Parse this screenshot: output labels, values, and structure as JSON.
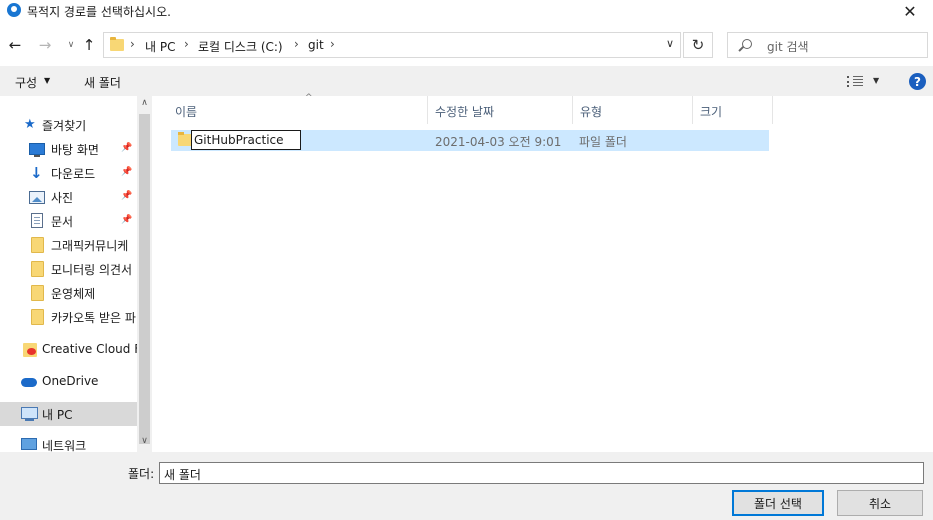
{
  "window": {
    "title": "목적지 경로를 선택하십시오.",
    "close": "✕"
  },
  "nav": {
    "back": "←",
    "forward": "→",
    "recent": "∨",
    "up": "↑",
    "refresh": "↻"
  },
  "address": {
    "crumbs": [
      "내 PC",
      "로컬 디스크 (C:)",
      "git"
    ],
    "separator": "›",
    "dropdown": "∨"
  },
  "search": {
    "placeholder": "git 검색"
  },
  "toolbar": {
    "organize": "구성",
    "organize_caret": "▼",
    "new_folder": "새 폴더",
    "view_caret": "▼",
    "help": "?"
  },
  "sidebar": {
    "items": [
      {
        "label": "즐겨찾기",
        "icon": "star-icon"
      },
      {
        "label": "바탕 화면",
        "icon": "desktop-icon",
        "pinned": true
      },
      {
        "label": "다운로드",
        "icon": "download-icon",
        "pinned": true
      },
      {
        "label": "사진",
        "icon": "pictures-icon",
        "pinned": true
      },
      {
        "label": "문서",
        "icon": "documents-icon",
        "pinned": true
      },
      {
        "label": "그래픽커뮤니케",
        "icon": "folder-icon"
      },
      {
        "label": "모니터링 의견서",
        "icon": "folder-icon"
      },
      {
        "label": "운영체제",
        "icon": "folder-icon"
      },
      {
        "label": "카카오톡 받은 파",
        "icon": "folder-icon"
      },
      {
        "label": "Creative Cloud Fil",
        "icon": "creative-cloud-icon"
      },
      {
        "label": "OneDrive",
        "icon": "onedrive-icon"
      },
      {
        "label": "내 PC",
        "icon": "pc-icon",
        "selected": true
      },
      {
        "label": "네트워크",
        "icon": "network-icon"
      }
    ],
    "pin_glyph": "📌",
    "scroll_up": "∧",
    "scroll_down": "∨"
  },
  "columns": {
    "name": "이름",
    "modified": "수정한 날짜",
    "type": "유형",
    "size": "크기",
    "sort_glyph": "^"
  },
  "files": [
    {
      "name": "GitHubPractice",
      "modified": "2021-04-03 오전 9:01",
      "type": "파일 폴더",
      "size": ""
    }
  ],
  "footer": {
    "folder_label": "폴더:",
    "folder_value": "새 폴더",
    "select_button": "폴더 선택",
    "cancel_button": "취소"
  }
}
